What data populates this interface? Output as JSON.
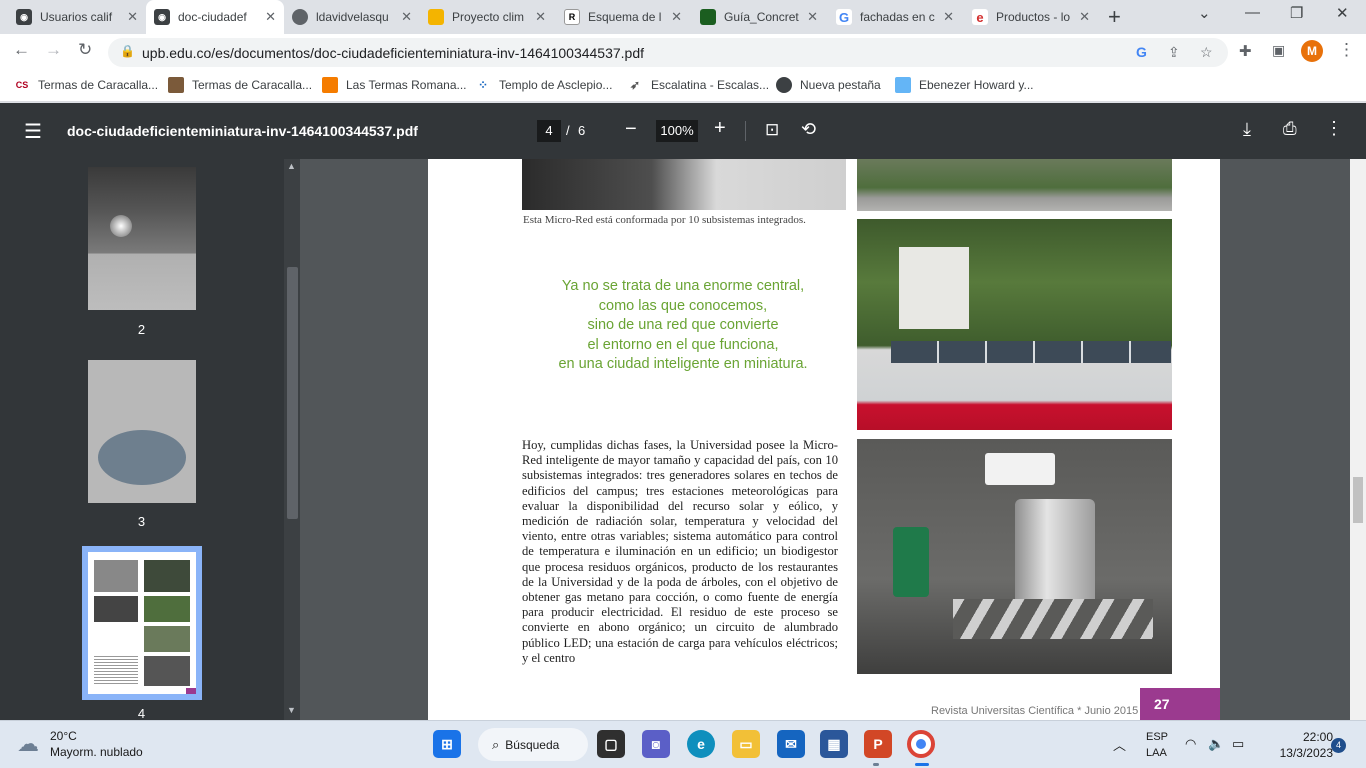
{
  "browser": {
    "tabs": [
      {
        "title": "Usuarios calif",
        "favicon": "vc"
      },
      {
        "title": "doc-ciudadef",
        "favicon": "vc",
        "active": true
      },
      {
        "title": "ldavidvelasqu",
        "favicon": "globe"
      },
      {
        "title": "Proyecto clim",
        "favicon": "slides"
      },
      {
        "title": "Esquema de l",
        "favicon": "rg"
      },
      {
        "title": "Guía_Concret",
        "favicon": "doc-green"
      },
      {
        "title": "fachadas en c",
        "favicon": "google"
      },
      {
        "title": "Productos - lo",
        "favicon": "e-red"
      }
    ],
    "url": "upb.edu.co/es/documentos/doc-ciudadeficienteminiatura-inv-1464100344537.pdf",
    "profile_initial": "M",
    "bookmarks": [
      {
        "label": "Termas de Caracalla...",
        "icon": "CS"
      },
      {
        "label": "Termas de Caracalla...",
        "icon": "img"
      },
      {
        "label": "Las Termas Romana...",
        "icon": "orange"
      },
      {
        "label": "Templo de Asclepio...",
        "icon": "dots"
      },
      {
        "label": "Escalatina - Escalas...",
        "icon": "bird"
      },
      {
        "label": "Nueva pestaña",
        "icon": "globe"
      },
      {
        "label": "Ebenezer Howard y...",
        "icon": "img2"
      }
    ]
  },
  "pdf": {
    "title": "doc-ciudadeficienteminiatura-inv-1464100344537.pdf",
    "current_page": "4",
    "separator": "/",
    "total_pages": "6",
    "zoom": "100%",
    "thumbnails": [
      {
        "label": "2"
      },
      {
        "label": "3"
      },
      {
        "label": "4"
      }
    ],
    "page": {
      "caption": "Esta Micro-Red está conformada por 10 subsistemas integrados.",
      "quote_lines": [
        "Ya no se trata de una enorme central,",
        "como las que conocemos,",
        "sino de una red que convierte",
        "el entorno en el que funciona,",
        "en una ciudad inteligente en miniatura."
      ],
      "body": "Hoy, cumplidas dichas fases, la Universidad posee la Micro-Red inteligente de mayor tamaño y capacidad del país, con 10 subsistemas integrados: tres generadores solares en techos de edificios del campus; tres estaciones meteorológicas para evaluar la disponibilidad del recurso solar y eólico, y medición de radiación solar, temperatura y velocidad del viento, entre otras variables; sistema automático para control de temperatura e iluminación en un edificio; un biodigestor que procesa residuos orgánicos, producto de los restaurantes de la Universidad y de la poda de árboles, con el objetivo de obtener gas metano para cocción, o como fuente de energía para producir electricidad. El residuo de este proceso se convierte en abono orgánico; un circuito de alumbrado público LED; una estación de carga para vehículos eléctricos; y el centro",
      "footer": "Revista Universitas Científica * Junio 2015",
      "page_number": "27"
    }
  },
  "taskbar": {
    "weather_temp": "20°C",
    "weather_desc": "Mayorm. nublado",
    "search_label": "Búsqueda",
    "lang_top": "ESP",
    "lang_bottom": "LAA",
    "time": "22:00",
    "date": "13/3/2023",
    "notifications": "4"
  },
  "colors": {
    "accent_green": "#6aa434",
    "page_badge": "#9b3a8f",
    "pdf_toolbar": "#323639",
    "thumbnail_selected": "#8ab4f8"
  }
}
